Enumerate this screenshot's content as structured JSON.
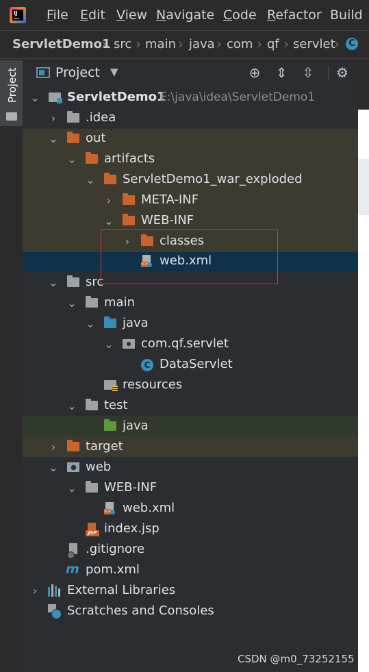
{
  "menu": [
    {
      "mn": "F",
      "rest": "ile"
    },
    {
      "mn": "E",
      "rest": "dit"
    },
    {
      "mn": "V",
      "rest": "iew"
    },
    {
      "mn": "N",
      "rest": "avigate"
    },
    {
      "mn": "C",
      "rest": "ode"
    },
    {
      "mn": "R",
      "rest": "efactor"
    },
    {
      "mn": "",
      "rest": "Build"
    }
  ],
  "logo_text": "IJ",
  "breadcrumbs": [
    "ServletDemo1",
    "src",
    "main",
    "java",
    "com",
    "qf",
    "servlet"
  ],
  "breadcrumb_badge": "C",
  "side_tab": "Project",
  "panel": {
    "title": "Project"
  },
  "tree": [
    {
      "label": "ServletDemo1",
      "path": "E:\\java\\idea\\ServletDemo1"
    },
    {
      "label": ".idea"
    },
    {
      "label": "out"
    },
    {
      "label": "artifacts"
    },
    {
      "label": "ServletDemo1_war_exploded"
    },
    {
      "label": "META-INF"
    },
    {
      "label": "WEB-INF"
    },
    {
      "label": "classes"
    },
    {
      "label": "web.xml"
    },
    {
      "label": "src"
    },
    {
      "label": "main"
    },
    {
      "label": "java"
    },
    {
      "label": "com.qf.servlet"
    },
    {
      "label": "DataServlet",
      "badge": "C"
    },
    {
      "label": "resources"
    },
    {
      "label": "test"
    },
    {
      "label": "java"
    },
    {
      "label": "target"
    },
    {
      "label": "web"
    },
    {
      "label": "WEB-INF"
    },
    {
      "label": "web.xml"
    },
    {
      "label": "index.jsp",
      "badge": "JSP"
    },
    {
      "label": ".gitignore"
    },
    {
      "label": "pom.xml",
      "badge": "m"
    },
    {
      "label": "External Libraries"
    },
    {
      "label": "Scratches and Consoles"
    }
  ],
  "watermark": "CSDN @m0_73252155",
  "colors": {
    "selection": "#10314a",
    "excluded": "#3d3b2f",
    "test": "#31392d",
    "highlight_box": "#d63a3a"
  }
}
